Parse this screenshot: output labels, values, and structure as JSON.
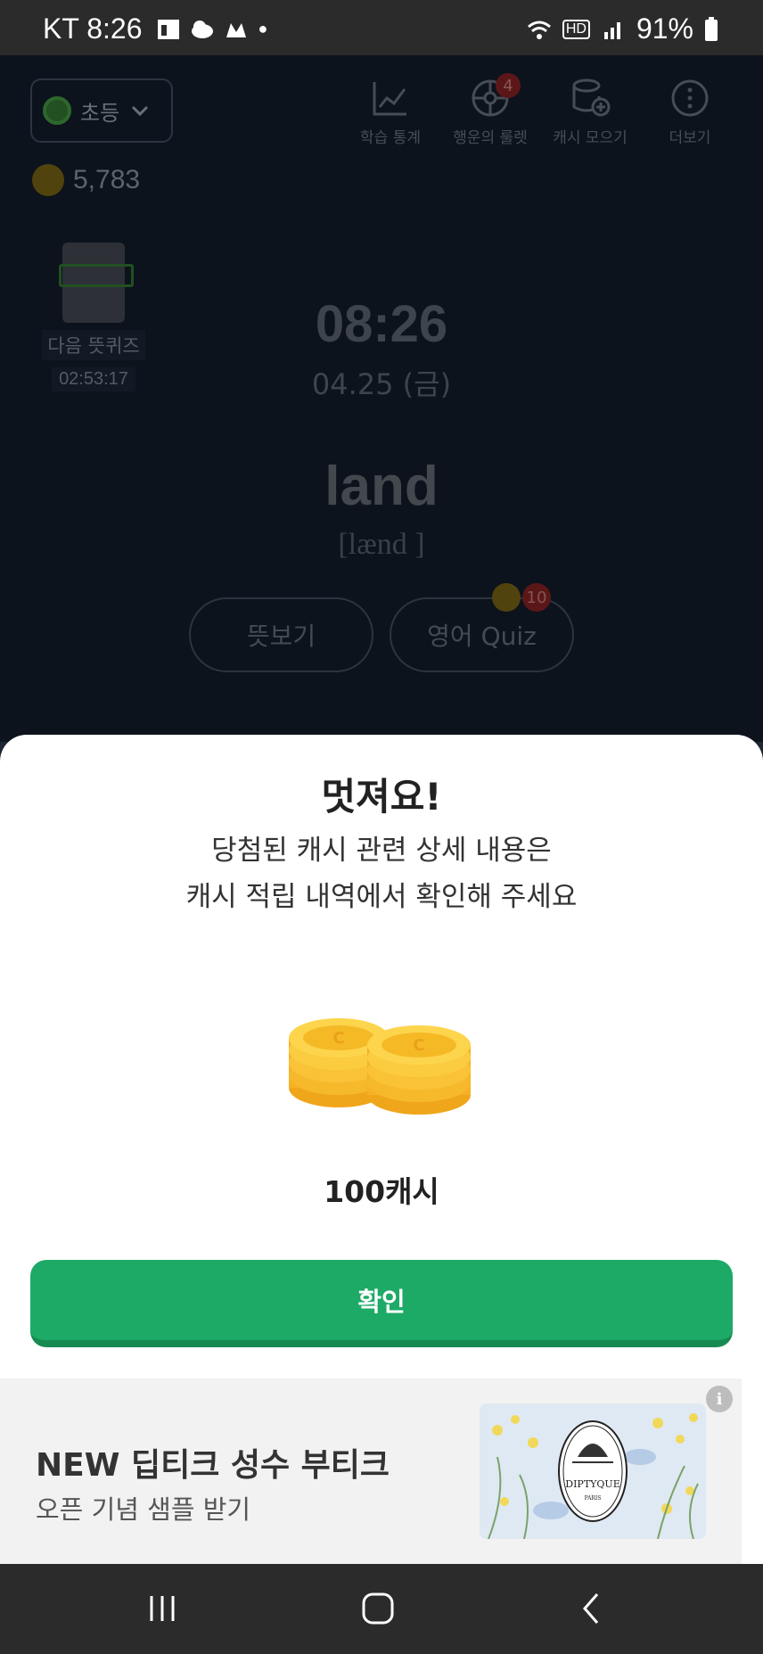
{
  "status_bar": {
    "carrier_time": "KT 8:26",
    "battery": "91%",
    "hd_label": "HD"
  },
  "app": {
    "level": "초등",
    "cash_balance": "5,783",
    "menu": [
      {
        "label": "학습 통계",
        "icon": "chart-icon"
      },
      {
        "label": "행운의 룰렛",
        "icon": "roulette-icon",
        "badge": "4"
      },
      {
        "label": "캐시 모으기",
        "icon": "coins-icon"
      },
      {
        "label": "더보기",
        "icon": "more-icon"
      }
    ],
    "next_quiz_label": "다음 뜻퀴즈",
    "next_quiz_timer": "02:53:17",
    "clock": "08:26",
    "date": "04.25 (금)",
    "word": "land",
    "phonetic": "[lænd ]",
    "meaning_button": "뜻보기",
    "quiz_button": "영어 Quiz",
    "quiz_reward": "10"
  },
  "sheet": {
    "title": "멋져요!",
    "desc_line1": "당첨된 캐시 관련 상세 내용은",
    "desc_line2": "캐시 적립 내역에서 확인해 주세요",
    "amount": "100캐시",
    "confirm": "확인"
  },
  "ad": {
    "title": "NEW 딥티크 성수 부티크",
    "subtitle": "오픈 기념 샘플 받기",
    "info": "i",
    "brand_logo": "DIPTYQUE",
    "brand_sub": "PARIS"
  },
  "colors": {
    "accent_green": "#1caa66",
    "coin_gold": "#f5a623"
  }
}
